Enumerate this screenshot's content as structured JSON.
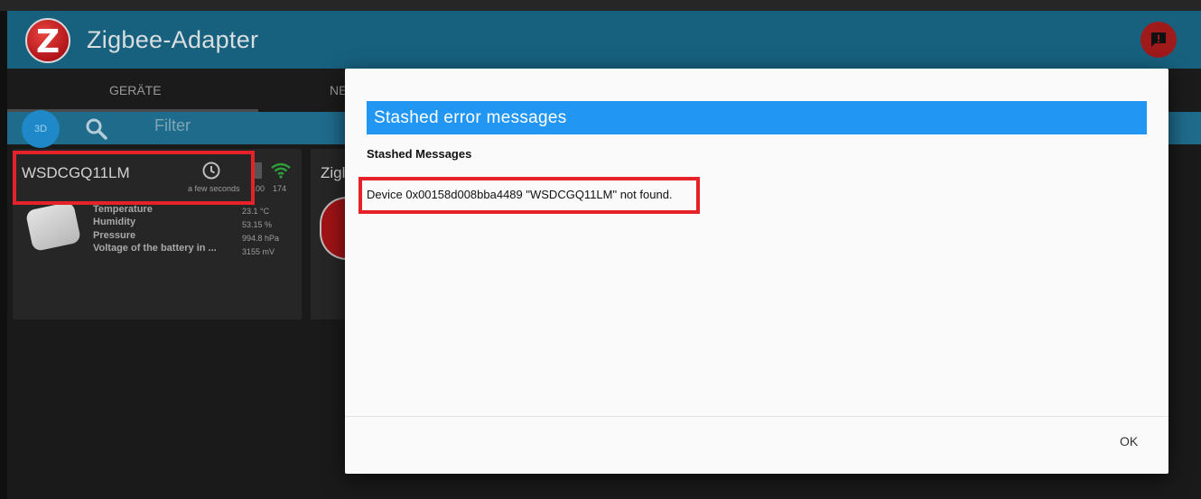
{
  "app": {
    "title": "Zigbee-Adapter",
    "logo_letter": "Z",
    "tabs": [
      {
        "label": "GERÄTE"
      },
      {
        "label": "NE"
      }
    ],
    "filter_placeholder": "Filter",
    "button_3d_label": "3D"
  },
  "devices": [
    {
      "name": "WSDCGQ11LM",
      "last_seen": "a few seconds",
      "battery": "100",
      "link_quality": "174",
      "properties": [
        {
          "label": "Temperature",
          "value": "23.1 °C"
        },
        {
          "label": "Humidity",
          "value": "53.15 %"
        },
        {
          "label": "Pressure",
          "value": "994.8 hPa"
        },
        {
          "label": "Voltage of the battery in ...",
          "value": "3155 mV"
        }
      ]
    },
    {
      "name": "Zigl"
    }
  ],
  "dialog": {
    "title": "Stashed error messages",
    "subtitle": "Stashed Messages",
    "message": "Device 0x00158d008bba4489 \"WSDCGQ11LM\" not found.",
    "ok_label": "OK"
  },
  "colors": {
    "header": "#17617f",
    "filter_bar": "#1f6b8c",
    "dialog_title_bg": "#2196f3",
    "highlight": "#e5222a",
    "alert_button": "#9f1a1a"
  },
  "icons": {
    "header_alert": "alert-comment-icon",
    "search": "search-icon",
    "last_seen": "clock-icon",
    "battery": "battery-icon",
    "signal": "wifi-signal-icon"
  }
}
